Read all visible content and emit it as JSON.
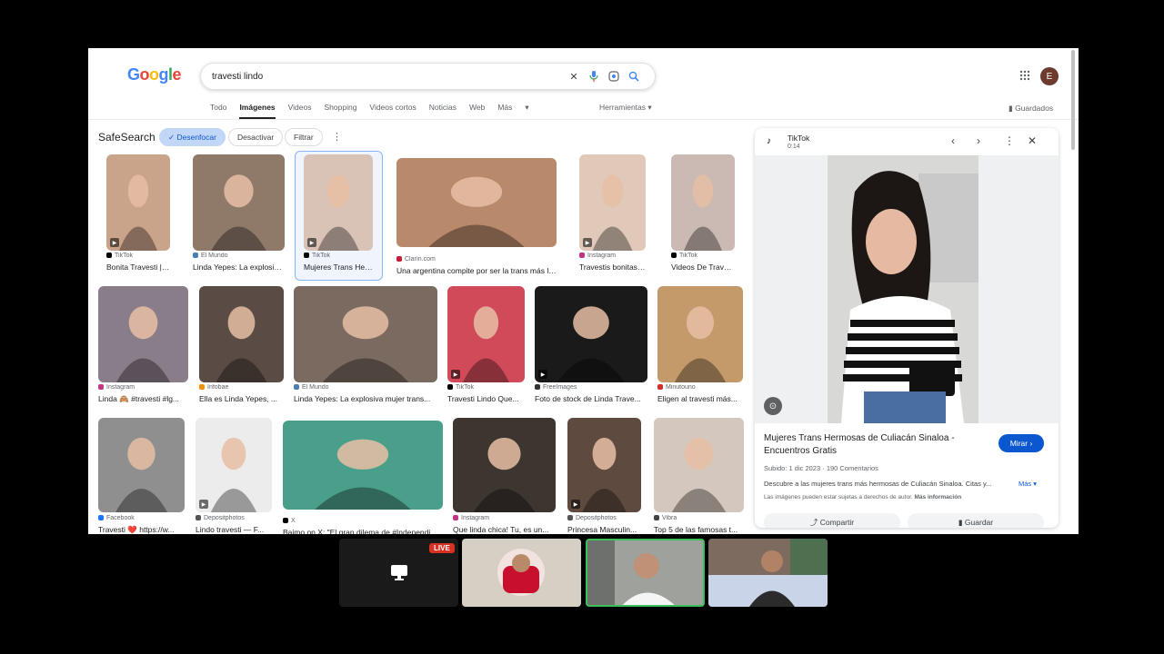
{
  "search": {
    "query": "travesti lindo",
    "clear_icon": "close-icon",
    "voice_icon": "mic-icon",
    "lens_icon": "lens-icon",
    "search_icon": "search-icon"
  },
  "header": {
    "logo": [
      "G",
      "o",
      "o",
      "g",
      "l",
      "e"
    ],
    "logo_colors": [
      "#4285F4",
      "#EA4335",
      "#FBBC05",
      "#4285F4",
      "#34A853",
      "#EA4335"
    ],
    "avatar_letter": "E"
  },
  "tabs": [
    "Todo",
    "Imágenes",
    "Videos",
    "Shopping",
    "Videos cortos",
    "Noticias",
    "Web",
    "Más"
  ],
  "tools_label": "Herramientas",
  "saved_label": "Guardados",
  "safesearch": {
    "label": "SafeSearch",
    "blur": "Desenfocar",
    "off": "Desactivar",
    "filter": "Filtrar"
  },
  "results": [
    {
      "source": "TikTok",
      "title": "Bonita Travesti | Tik...",
      "color": "#000000"
    },
    {
      "source": "El Mundo",
      "title": "Linda Yepes: La explosiva...",
      "color": "#4a7fb5"
    },
    {
      "source": "TikTok",
      "title": "Mujeres Trans Her...",
      "color": "#000000"
    },
    {
      "source": "Clarín.com",
      "title": "Una argentina compite por ser la trans más lin...",
      "color": "#c41e3a"
    },
    {
      "source": "Instagram",
      "title": "Travestis bonitas n...",
      "color": "#c13584"
    },
    {
      "source": "TikTok",
      "title": "Videos De Travesti ...",
      "color": "#000000"
    },
    {
      "source": "Instagram",
      "title": "Linda 🙈 #travesti #lg...",
      "color": "#c13584"
    },
    {
      "source": "Infobae",
      "title": "Ella es Linda Yepes, ...",
      "color": "#f29100"
    },
    {
      "source": "El Mundo",
      "title": "Linda Yepes: La explosiva mujer trans...",
      "color": "#4a7fb5"
    },
    {
      "source": "TikTok",
      "title": "Travesti Lindo Que...",
      "color": "#000000"
    },
    {
      "source": "FreeImages",
      "title": "Foto de stock de Linda Trave...",
      "color": "#333333"
    },
    {
      "source": "Minutouno",
      "title": "Eligen al travesti más...",
      "color": "#d62d2d"
    },
    {
      "source": "Facebook",
      "title": "Travesti ❤️ https://w...",
      "color": "#1877f2"
    },
    {
      "source": "Depositphotos",
      "title": "Lindo travesti — F...",
      "color": "#555555"
    },
    {
      "source": "X",
      "title": "Baimo on X: \"El gran dilema de #Independi...",
      "color": "#000000"
    },
    {
      "source": "Instagram",
      "title": "Que linda chica! Tu, es un...",
      "color": "#c13584"
    },
    {
      "source": "Depositphotos",
      "title": "Princesa Masculin...",
      "color": "#555555"
    },
    {
      "source": "Vibra",
      "title": "Top 5 de las famosas t...",
      "color": "#444444"
    }
  ],
  "panel": {
    "source": "TikTok",
    "duration": "0:14",
    "title": "Mujeres Trans Hermosas de Culiacán Sinaloa - Encuentros Gratis",
    "watch": "Mirar",
    "uploaded": "Subido: 1 dic 2023",
    "comments": "190 Comentarios",
    "description": "Descubre a las mujeres trans más hermosas de Culiacán Sinaloa. Citas y...",
    "more": "Más",
    "rights_text": "Las imágenes pueden estar sujetas a derechos de autor.",
    "rights_link": "Más información",
    "share": "Compartir",
    "save": "Guardar"
  },
  "call": {
    "live": "LIVE"
  }
}
